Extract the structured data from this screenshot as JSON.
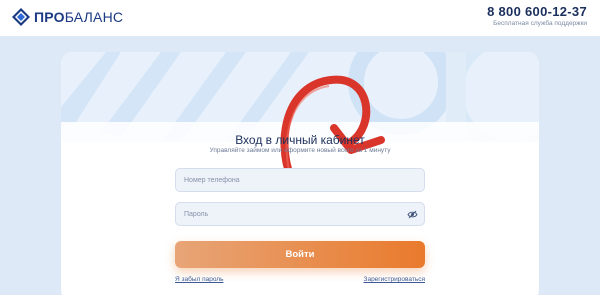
{
  "header": {
    "brand_strong": "ПРО",
    "brand_rest": "БАЛАНС",
    "phone": "8 800 600-12-37",
    "phone_caption": "Бесплатная служба поддержки"
  },
  "login": {
    "title": "Вход в личный кабинет",
    "subtitle": "Управляйте займом или оформите новый всего за 1 минуту",
    "phone_placeholder": "Номер телефона",
    "password_placeholder": "Пароль",
    "submit_label": "Войти",
    "forgot_password_label": "Я забыл пароль",
    "register_label": "Зарегистрироваться"
  },
  "icons": {
    "logo": "diamond-logo-icon",
    "password_toggle": "eye-off-icon",
    "annotation": "curved-arrow-icon"
  },
  "colors": {
    "brand": "#1b3a84",
    "accent": "#e97a2c",
    "annotation": "#d9352b",
    "background": "#dde9f6"
  }
}
